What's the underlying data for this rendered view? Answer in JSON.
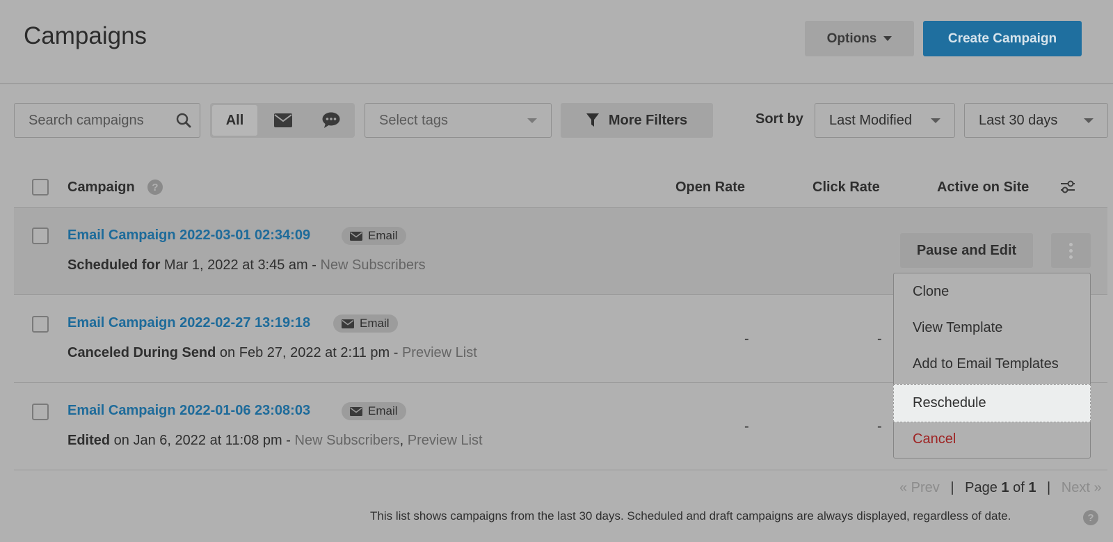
{
  "header": {
    "title": "Campaigns",
    "options_label": "Options",
    "create_label": "Create Campaign"
  },
  "toolbar": {
    "search_placeholder": "Search campaigns",
    "filter_all": "All",
    "tags_placeholder": "Select tags",
    "more_filters": "More Filters",
    "sort_by_label": "Sort by",
    "sort_value": "Last Modified",
    "date_range_value": "Last 30 days"
  },
  "table": {
    "columns": {
      "campaign": "Campaign",
      "open_rate": "Open Rate",
      "click_rate": "Click Rate",
      "active_on_site": "Active on Site"
    },
    "rows": [
      {
        "name": "Email Campaign 2022-03-01 02:34:09",
        "badge": "Email",
        "status": "Scheduled for",
        "detail": " Mar 1, 2022 at 3:45 am - ",
        "lists": "New Subscribers",
        "action": "Pause and Edit"
      },
      {
        "name": "Email Campaign 2022-02-27 13:19:18",
        "badge": "Email",
        "status": "Canceled During Send",
        "detail": " on Feb 27, 2022 at 2:11 pm - ",
        "lists": "Preview List",
        "open_rate": "-",
        "click_rate": "-"
      },
      {
        "name": "Email Campaign 2022-01-06 23:08:03",
        "badge": "Email",
        "status": "Edited",
        "detail": " on Jan 6, 2022 at 11:08 pm - ",
        "lists": "New Subscribers",
        "lists_sep": ", ",
        "lists2": "Preview List",
        "open_rate": "-",
        "click_rate": "-"
      }
    ]
  },
  "menu": {
    "items": [
      "Clone",
      "View Template",
      "Add to Email Templates",
      "Reschedule",
      "Cancel"
    ]
  },
  "pager": {
    "prev": "« Prev",
    "sep": "|",
    "page_prefix": "Page ",
    "current": "1",
    "of": " of ",
    "total": "1",
    "next": "Next »"
  },
  "footer": {
    "note": "This list shows campaigns from the last 30 days. Scheduled and draft campaigns are always displayed, regardless of date."
  },
  "colors": {
    "overlay_bg": "#b1b1b1",
    "primary": "#1f6f9f",
    "link": "#1e6b9a",
    "danger": "#9e2424",
    "highlight": "#eceeee"
  }
}
